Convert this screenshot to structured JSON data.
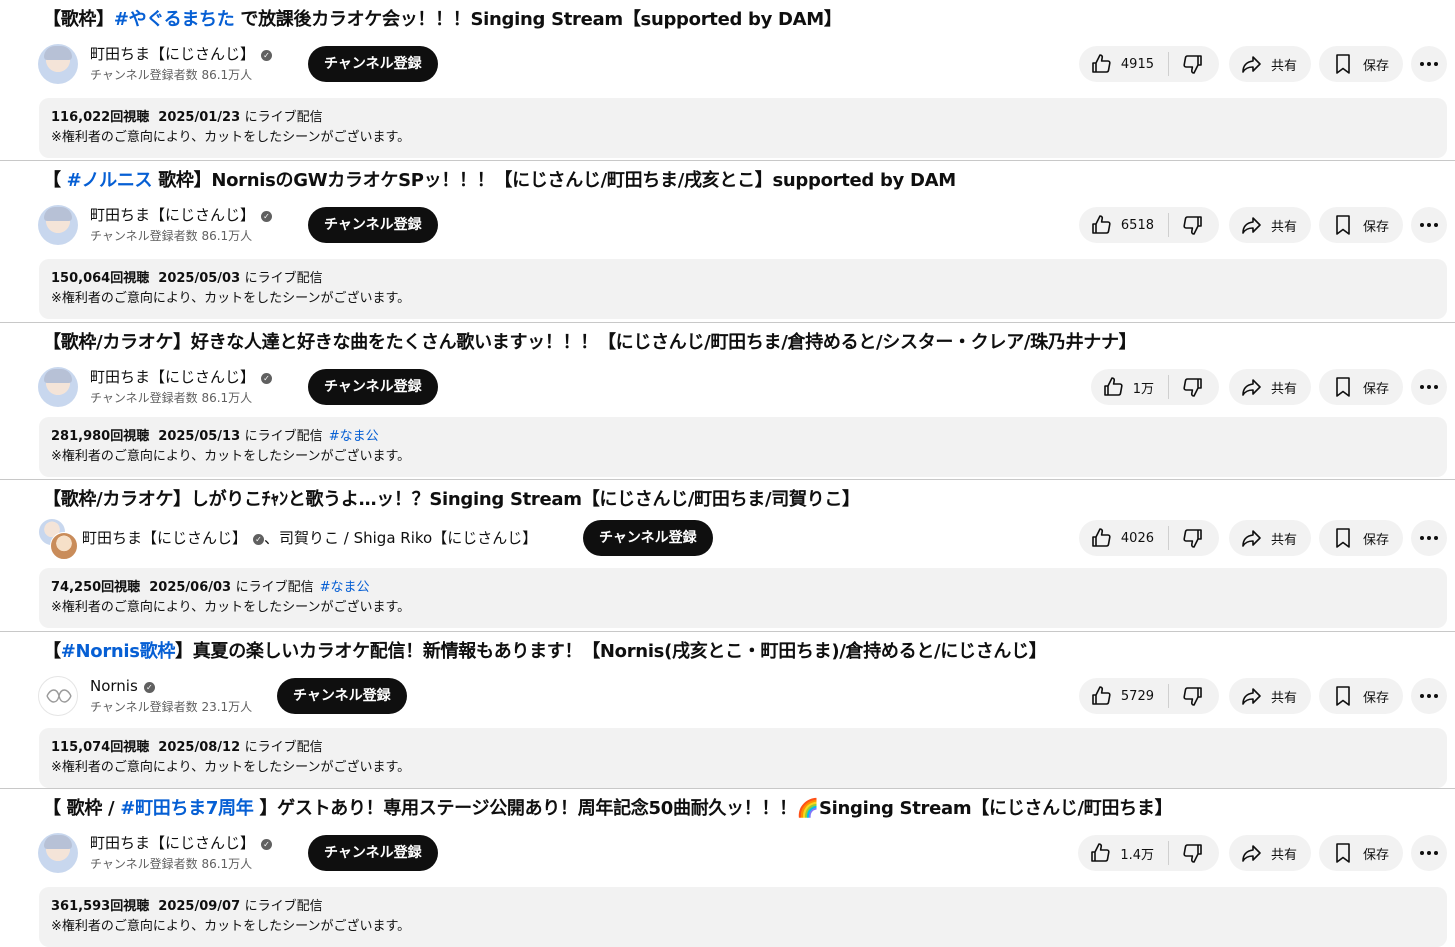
{
  "videos": [
    {
      "title_prefix": "【歌枠】",
      "title_hashtag": "#やぐるまちた",
      "title_suffix": " で放課後カラオケ会ッ！！！Singing Stream【supported by DAM】",
      "channel": "町田ちま【にじさんじ】",
      "subscribers": "チャンネル登録者数 86.1万人",
      "subscribe_label": "チャンネル登録",
      "likes": "4915",
      "share_label": "共有",
      "save_label": "保存",
      "views": "116,022回視聴",
      "date": "2025/01/23",
      "live_label": "にライブ配信",
      "desc_tag": "",
      "note": "※権利者のご意向により、カットをしたシーンがございます。"
    },
    {
      "title_prefix": "【",
      "title_hashtag": " #ノルニス",
      "title_suffix": " 歌枠】NornisのGWカラオケSPッ！！！【にじさんじ/町田ちま/戌亥とこ】supported by DAM",
      "channel": "町田ちま【にじさんじ】",
      "subscribers": "チャンネル登録者数 86.1万人",
      "subscribe_label": "チャンネル登録",
      "likes": "6518",
      "share_label": "共有",
      "save_label": "保存",
      "views": "150,064回視聴",
      "date": "2025/05/03",
      "live_label": "にライブ配信",
      "desc_tag": "",
      "note": "※権利者のご意向により、カットをしたシーンがございます。"
    },
    {
      "title_prefix": "【歌枠/カラオケ】好きな人達と好きな曲をたくさん歌いますッ！！！【にじさんじ/町田ちま/倉持めると/シスター・クレア/珠乃井ナナ】",
      "title_hashtag": "",
      "title_suffix": "",
      "channel": "町田ちま【にじさんじ】",
      "subscribers": "チャンネル登録者数 86.1万人",
      "subscribe_label": "チャンネル登録",
      "likes": "1万",
      "share_label": "共有",
      "save_label": "保存",
      "views": "281,980回視聴",
      "date": "2025/05/13",
      "live_label": "にライブ配信",
      "desc_tag": "#なま公",
      "note": "※権利者のご意向により、カットをしたシーンがございます。"
    },
    {
      "title_prefix": "【歌枠/カラオケ】しがりこﾁｬﾝと歌うよ…ッ！？Singing Stream【にじさんじ/町田ちま/司賀りこ】",
      "title_hashtag": "",
      "title_suffix": "",
      "channel": "町田ちま【にじさんじ】",
      "channel_second": "、司賀りこ / Shiga Riko【にじさんじ】",
      "subscribers": "",
      "subscribe_label": "チャンネル登録",
      "likes": "4026",
      "share_label": "共有",
      "save_label": "保存",
      "views": "74,250回視聴",
      "date": "2025/06/03",
      "live_label": "にライブ配信",
      "desc_tag": "#なま公",
      "note": "※権利者のご意向により、カットをしたシーンがございます。"
    },
    {
      "title_prefix": "【",
      "title_hashtag": "#Nornis歌枠",
      "title_suffix": "】真夏の楽しいカラオケ配信！新情報もあります！【Nornis(戌亥とこ・町田ちま)/倉持めると/にじさんじ】",
      "channel": "Nornis",
      "subscribers": "チャンネル登録者数 23.1万人",
      "subscribe_label": "チャンネル登録",
      "likes": "5729",
      "share_label": "共有",
      "save_label": "保存",
      "views": "115,074回視聴",
      "date": "2025/08/12",
      "live_label": "にライブ配信",
      "desc_tag": "",
      "note": "※権利者のご意向により、カットをしたシーンがございます。"
    },
    {
      "title_prefix": "【 歌枠 / ",
      "title_hashtag": "#町田ちま7周年",
      "title_suffix": " 】ゲストあり！専用ステージ公開あり！周年記念50曲耐久ッ！！！🌈Singing Stream【にじさんじ/町田ちま】",
      "channel": "町田ちま【にじさんじ】",
      "subscribers": "チャンネル登録者数 86.1万人",
      "subscribe_label": "チャンネル登録",
      "likes": "1.4万",
      "share_label": "共有",
      "save_label": "保存",
      "views": "361,593回視聴",
      "date": "2025/09/07",
      "live_label": "にライブ配信",
      "desc_tag": "",
      "note": "※権利者のご意向により、カットをしたシーンがございます。"
    }
  ],
  "icons": {
    "like": "thumbs-up-icon",
    "dislike": "thumbs-down-icon",
    "share": "share-arrow-icon",
    "save": "bookmark-icon",
    "more": "more-horizontal-icon",
    "verified": "verified-check-icon"
  },
  "colors": {
    "hashtag": "#065fd4",
    "subscribe_bg": "#0f0f0f",
    "pill_bg": "#f2f2f2",
    "secondary_text": "#606060"
  }
}
